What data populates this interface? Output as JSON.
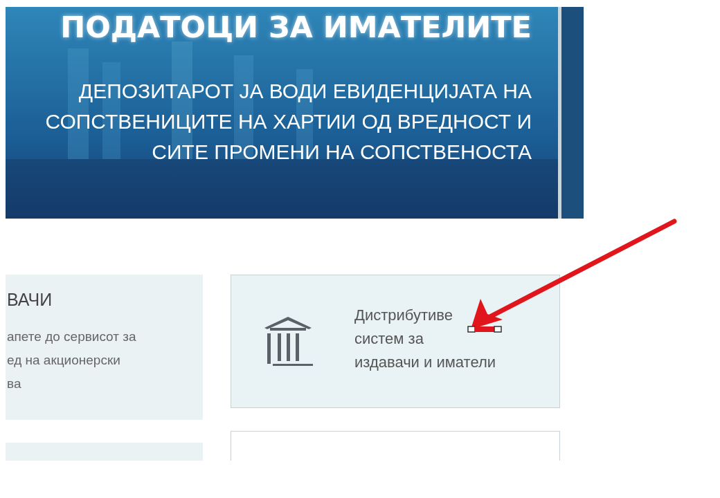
{
  "banner": {
    "title": "ПОДАТОЦИ ЗА ИМАТЕЛИТЕ",
    "subtitle_lines": [
      "ДЕПОЗИТАРОТ ЈА ВОДИ ЕВИДЕНЦИЈАТА НА",
      "СОПСТВЕНИЦИТЕ НА ХАРТИИ ОД ВРЕДНОСТ И",
      "СИТЕ ПРОМЕНИ НА СОПСТВЕНОСТА"
    ]
  },
  "cards": [
    {
      "kind": "text",
      "title": "ВАЧИ",
      "lines": [
        "апете до сервисот за",
        "ед на акционерски",
        "ва"
      ]
    },
    {
      "kind": "icon",
      "lines": [
        "Дистрибутиве",
        "систем за",
        "издавачи и иматели"
      ]
    }
  ]
}
